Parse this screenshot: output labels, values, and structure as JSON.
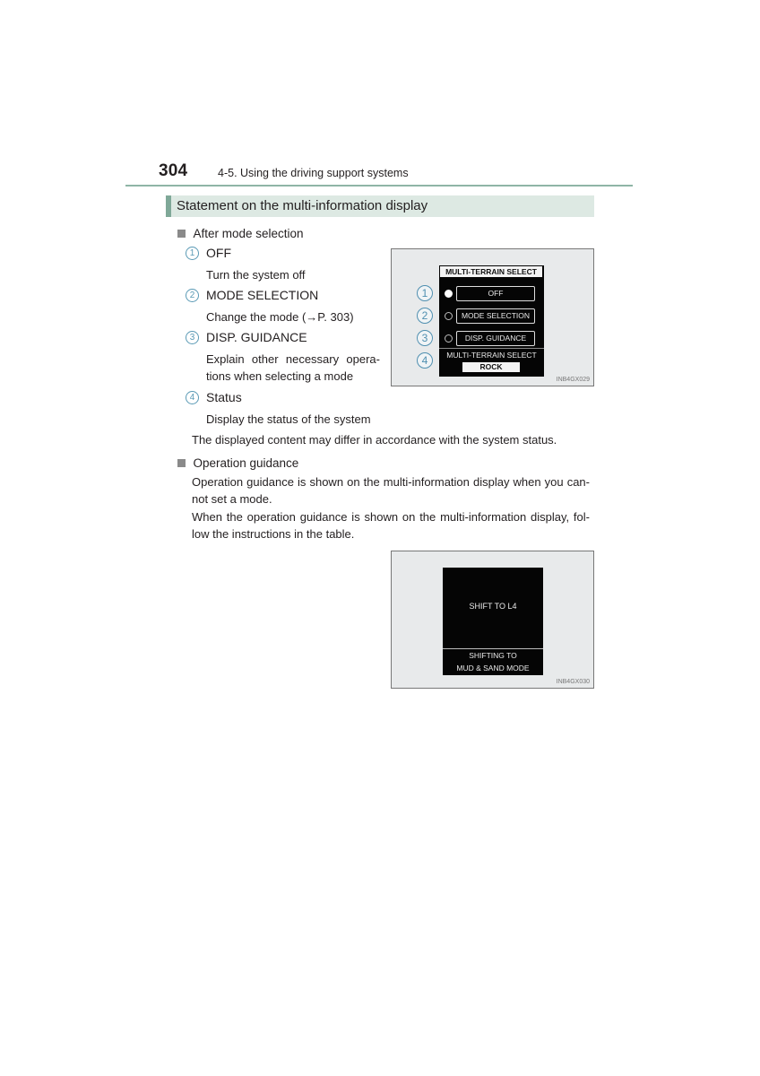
{
  "header": {
    "page_number": "304",
    "chapter": "4-5. Using the driving support systems"
  },
  "section": {
    "title": "Statement on the multi-information display"
  },
  "after_mode_selection": {
    "heading": "After mode selection",
    "items": [
      {
        "num": "1",
        "label": "OFF",
        "desc": "Turn the system off"
      },
      {
        "num": "2",
        "label": "MODE SELECTION",
        "desc": "Change the mode (→P. 303)"
      },
      {
        "num": "3",
        "label": "DISP. GUIDANCE",
        "desc_line1": "Explain other necessary opera-",
        "desc_line2": "tions when selecting a mode"
      },
      {
        "num": "4",
        "label": "Status",
        "desc": "Display the status of the system"
      }
    ],
    "note": "The displayed content may differ in accordance with the system status."
  },
  "figure1": {
    "screen_title": "MULTI-TERRAIN SELECT",
    "buttons": [
      "OFF",
      "MODE SELECTION",
      "DISP. GUIDANCE"
    ],
    "callouts": [
      "1",
      "2",
      "3",
      "4"
    ],
    "status_label": "MULTI-TERRAIN SELECT",
    "status_value": "ROCK",
    "code": "INB4GX029"
  },
  "operation_guidance": {
    "heading": "Operation guidance",
    "para1_line1": "Operation guidance is shown on the multi-information display when you can-",
    "para1_line2": "not set a mode.",
    "para2_line1": "When the operation guidance is shown on the multi-information display, fol-",
    "para2_line2": "low the instructions in the table."
  },
  "figure2": {
    "main_text": "SHIFT TO L4",
    "bottom_line1": "SHIFTING TO",
    "bottom_line2": "MUD & SAND MODE",
    "code": "INB4GX030"
  }
}
